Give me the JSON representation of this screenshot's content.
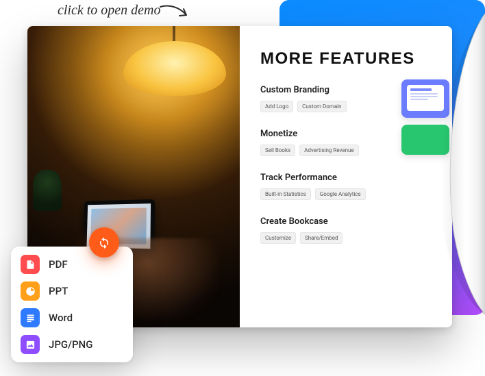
{
  "hint": "click to open demo",
  "right_page": {
    "title": "MORE FEATURES",
    "groups": [
      {
        "heading": "Custom Branding",
        "tags": [
          "Add Logo",
          "Custom Domain"
        ]
      },
      {
        "heading": "Monetize",
        "tags": [
          "Sell Books",
          "Advertising Revenue"
        ]
      },
      {
        "heading": "Track Performance",
        "tags": [
          "Built-in Statistics",
          "Google Analytics"
        ]
      },
      {
        "heading": "Create Bookcase",
        "tags": [
          "Customize",
          "Share/Embed"
        ]
      }
    ]
  },
  "formats": [
    {
      "key": "pdf",
      "label": "PDF"
    },
    {
      "key": "ppt",
      "label": "PPT"
    },
    {
      "key": "word",
      "label": "Word"
    },
    {
      "key": "img",
      "label": "JPG/PNG"
    }
  ]
}
